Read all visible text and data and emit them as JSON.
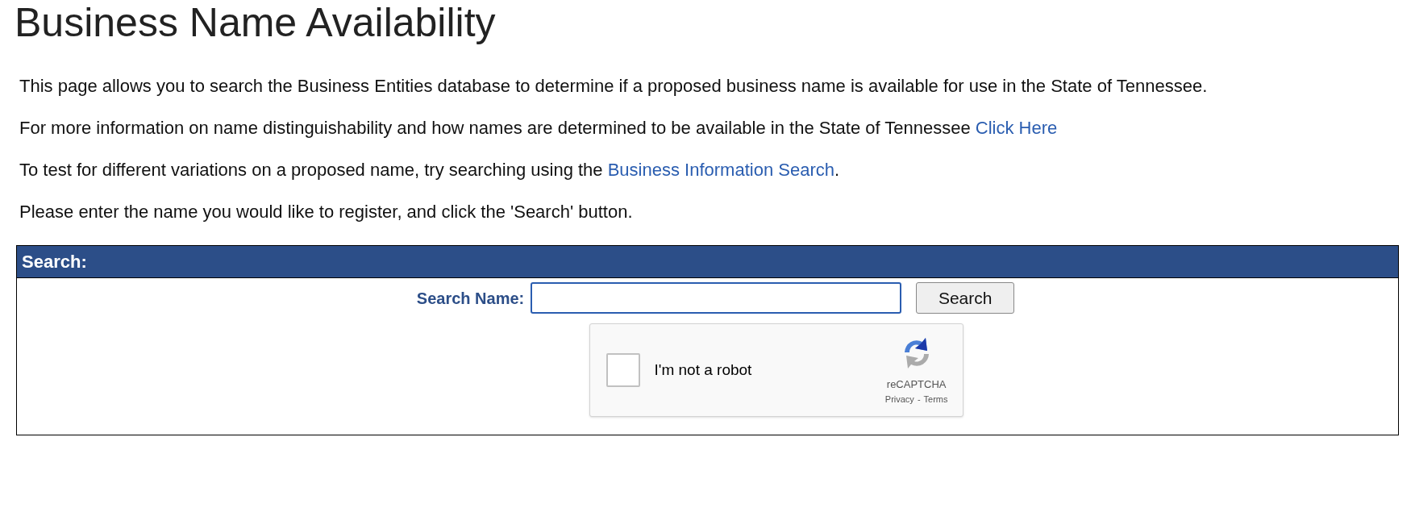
{
  "title": "Business Name Availability",
  "paragraphs": [
    [
      {
        "kind": "text",
        "text": "This page allows you to search the Business Entities database to determine if a proposed business name is available for use in the State of Tennessee."
      }
    ],
    [
      {
        "kind": "text",
        "text": "For more information on name distinguishability and how names are determined to be available in the State of Tennessee "
      },
      {
        "kind": "link",
        "text": "Click Here"
      }
    ],
    [
      {
        "kind": "text",
        "text": "To test for different variations on a proposed name, try searching using the "
      },
      {
        "kind": "link",
        "text": "Business Information Search"
      },
      {
        "kind": "text",
        "text": "."
      }
    ],
    [
      {
        "kind": "text",
        "text": "Please enter the name you would like to register, and click the 'Search' button."
      }
    ]
  ],
  "search_panel": {
    "header": "Search:",
    "field_label": "Search Name:",
    "button": "Search",
    "captcha": {
      "label": "I'm not a robot",
      "checked": false,
      "brand": "reCAPTCHA",
      "privacy": "Privacy",
      "separator": "-",
      "terms": "Terms"
    }
  }
}
